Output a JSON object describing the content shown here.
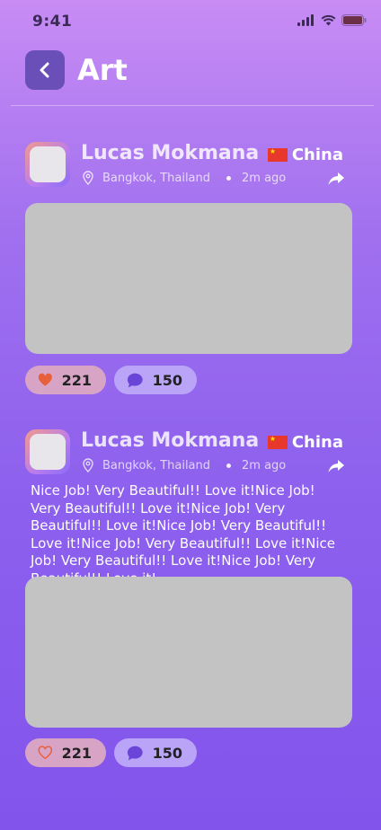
{
  "status": {
    "time": "9:41"
  },
  "header": {
    "title": "Art",
    "back_icon": "chevron-left-icon"
  },
  "posts": [
    {
      "author": "Lucas Mokmana",
      "location": "Bangkok, Thailand",
      "time_ago": "2m ago",
      "country": "China",
      "text": "",
      "likes": "221",
      "liked": true,
      "comments": "150"
    },
    {
      "author": "Lucas Mokmana",
      "location": "Bangkok, Thailand",
      "time_ago": "2m ago",
      "country": "China",
      "text": "Nice Job! Very Beautiful!! Love it!Nice Job! Very Beautiful!! Love it!Nice Job! Very Beautiful!! Love it!Nice Job! Very Beautiful!! Love it!Nice Job! Very Beautiful!! Love it!Nice Job! Very Beautiful!! Love it!Nice Job! Very Beautiful!! Love it!",
      "likes": "221",
      "liked": false,
      "comments": "150"
    }
  ],
  "colors": {
    "heart": "#e8603a",
    "comment_icon": "#6a45d8",
    "media_placeholder": "#c3c3c3"
  }
}
